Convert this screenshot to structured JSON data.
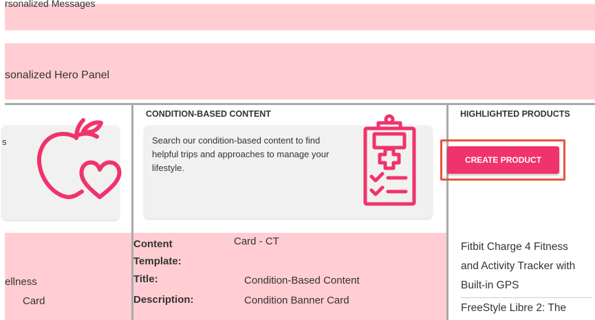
{
  "top_band": {
    "cut_text": "rsonalized Messages"
  },
  "hero_band": {
    "label": "sonalized Hero Panel"
  },
  "left_column": {
    "card_fragment": "s",
    "lines": [
      "ellness",
      "Card"
    ]
  },
  "middle_column": {
    "title": "CONDITION-BASED CONTENT",
    "card_description": "Search our condition-based content to find helpful trips and approaches to manage your lifestyle.",
    "meta": [
      {
        "label": "Content Template:",
        "value": "Card - CT"
      },
      {
        "label": "Title:",
        "value": "Condition-Based Content"
      },
      {
        "label": "Description:",
        "value": "Condition Banner Card"
      }
    ]
  },
  "right_column": {
    "title": "HIGHLIGHTED PRODUCTS",
    "create_button": "CREATE PRODUCT",
    "products": [
      "Fitbit Charge 4 Fitness and Activity Tracker with Built-in GPS",
      "FreeStyle Libre 2: The"
    ]
  },
  "icons": {
    "apple_heart": "apple-heart-icon",
    "clipboard": "clipboard-medical-icon"
  },
  "colors": {
    "accent_pink": "#f0336b",
    "band_pink": "#ffcdd2",
    "highlight_frame": "#e8543a",
    "card_bg": "#f1f1f1"
  }
}
